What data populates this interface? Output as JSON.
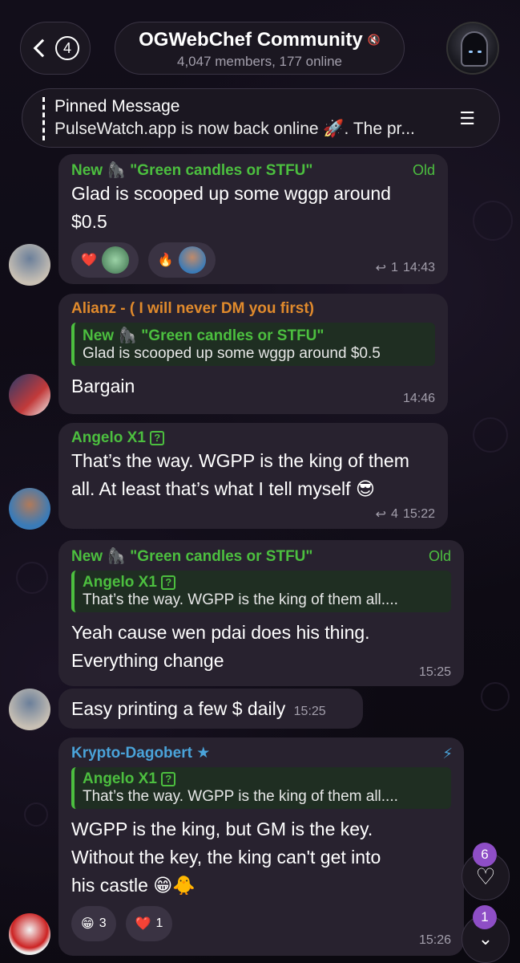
{
  "header": {
    "back_count": "4",
    "title": "OGWebChef Community",
    "subtitle": "4,047 members, 177 online"
  },
  "pinned": {
    "title": "Pinned Message",
    "text": "PulseWatch.app is now back online 🚀. The pr..."
  },
  "messages": [
    {
      "sender": "New 🦍 \"Green candles or STFU\"",
      "tag": "Old",
      "text_lines": [
        "Glad is scooped up some wggp around",
        "$0.5"
      ],
      "reactions": [
        "❤️",
        "🔥"
      ],
      "replies": "1",
      "time": "14:43"
    },
    {
      "sender": "Alianz - ( I will never DM you first)",
      "reply_name": "New 🦍 \"Green candles or STFU\"",
      "reply_text": "Glad is scooped up some wggp around $0.5",
      "text": "Bargain",
      "time": "14:46"
    },
    {
      "sender": "Angelo X1",
      "text_lines": [
        "That’s the way. WGPP is the king of them",
        "all. At least that’s what I tell myself 😎"
      ],
      "replies": "4",
      "time": "15:22"
    },
    {
      "sender": "New 🦍 \"Green candles or STFU\"",
      "tag": "Old",
      "reply_name": "Angelo X1",
      "reply_text": "That’s the way. WGPP is the king of them all....",
      "text_lines": [
        "Yeah cause wen pdai does his thing.",
        "Everything change"
      ],
      "time": "15:25"
    },
    {
      "text": "Easy printing a few $ daily",
      "time": "15:25"
    },
    {
      "sender": "Krypto-Dagobert",
      "reply_name": "Angelo X1",
      "reply_text": "That’s the way. WGPP is the king of them all....",
      "text_lines": [
        "WGPP is the king, but GM is the key.",
        "Without the key, the king can't get into",
        "his castle 😁🐥"
      ],
      "reactions": [
        {
          "emoji": "😁",
          "count": "3"
        },
        {
          "emoji": "❤️",
          "count": "1"
        }
      ],
      "time": "15:26"
    }
  ],
  "floating": {
    "reactions_badge": "6",
    "scroll_badge": "1"
  }
}
